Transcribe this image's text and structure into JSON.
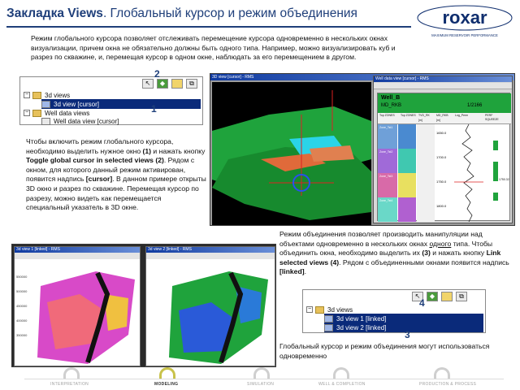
{
  "header": {
    "title_bold": "Закладка Views",
    "title_rest": ". Глобальный курсор и режим объединения"
  },
  "logo": {
    "name": "roxar",
    "tagline": "MAXIMUM RESERVOIR PERFORMANCE"
  },
  "intro": "Режим глобального курсора позволяет отслеживать перемещение курсора одновременно в нескольких окнах визуализации, причем окна не обязательно должны быть одного типа. Например, можно визуализировать куб и разрез по скважине, и, перемещая курсор в одном окне, наблюдать за его перемещением в другом.",
  "panel1": {
    "rows": [
      {
        "label": "3d views"
      },
      {
        "label": "3d view [cursor]"
      },
      {
        "label": "Well data views"
      },
      {
        "label": "Well data view [cursor]"
      }
    ],
    "marker_2": "2",
    "marker_1": "1"
  },
  "cursor_text": {
    "p1": "Чтобы включить режим глобального курсора, необходимо выделить нужное окно ",
    "p1_ref1": "(1)",
    "p1b": " и нажать кнопку ",
    "p1_bold": "Toggle global cursor in selected views (2)",
    "p1c": ". Рядом с окном, для которого данный режим активирован, появится надпись ",
    "p1_bold2": "[cursor]",
    "p1d": ". В данном примере открыты 3D окно и разрез по скважине. Перемещая курсор по разрезу, можно видеть как перемещается специальный указатель в 3D окне."
  },
  "screenshot_top": {
    "window_title": "3D view [cursor] - RMS",
    "well_window_title": "Well data view [cursor] - RMS",
    "well_name": "Well_B",
    "well_md": "MD_RKB",
    "scale": "1/2166",
    "col_headers": [
      "Top ZONES",
      "Top ZONES",
      "TVD_RK",
      "MD_RKB",
      "Log_Perm",
      "PERF",
      "SQUEEZE"
    ],
    "col_units": [
      "",
      "",
      "[m]",
      "[m]",
      "",
      "",
      ""
    ],
    "zone_labels": [
      "Zone_Tst1",
      "Zone_Tst2",
      "Zone_Tst3",
      "Zone_Tst4"
    ],
    "depths": [
      "1650.0",
      "1700.0",
      "1750.0",
      "1800.0"
    ],
    "depth_tags": [
      "1750.32"
    ]
  },
  "screenshot_bottom": {
    "left_title": "3d view 1 [linked] - RMS",
    "right_title": "3d view 2 [linked] - RMS",
    "axis_ticks": [
      "550000",
      "500000",
      "450000",
      "400000",
      "350000",
      "300000"
    ]
  },
  "link_text": {
    "p1": "Режим объединения позволяет производить манипуляции над объектами одновременно в нескольких окнах ",
    "p1_u": "одного",
    "p1b": " типа. Чтобы объединить окна, необходимо выделить их ",
    "p1_ref3": "(3)",
    "p1c": " и нажать кнопку ",
    "p1_bold": "Link selected views (4)",
    "p1d": ". Рядом с объединенными окнами появится надпись ",
    "p1_bold2": "[linked]",
    "p1e": "."
  },
  "panel2": {
    "rows": [
      {
        "label": "3d views"
      },
      {
        "label": "3d view 1 [linked]"
      },
      {
        "label": "3d view 2 [linked]"
      }
    ],
    "marker_4": "4",
    "marker_3": "3"
  },
  "note": "Глобальный курсор и режим объединения могут использоваться одновременно",
  "bottom_nav": [
    {
      "label": "INTERPRETATION",
      "active": false
    },
    {
      "label": "MODELING",
      "active": true
    },
    {
      "label": "SIMULATION",
      "active": false
    },
    {
      "label": "WELL & COMPLETION",
      "active": false
    },
    {
      "label": "PRODUCTION & PROCESS",
      "active": false
    }
  ],
  "colors": {
    "title_blue": "#1f3f7a",
    "selection": "#0a2a7a",
    "logo_blue": "#0f2e6e",
    "nav_active": "#c8c24a"
  }
}
